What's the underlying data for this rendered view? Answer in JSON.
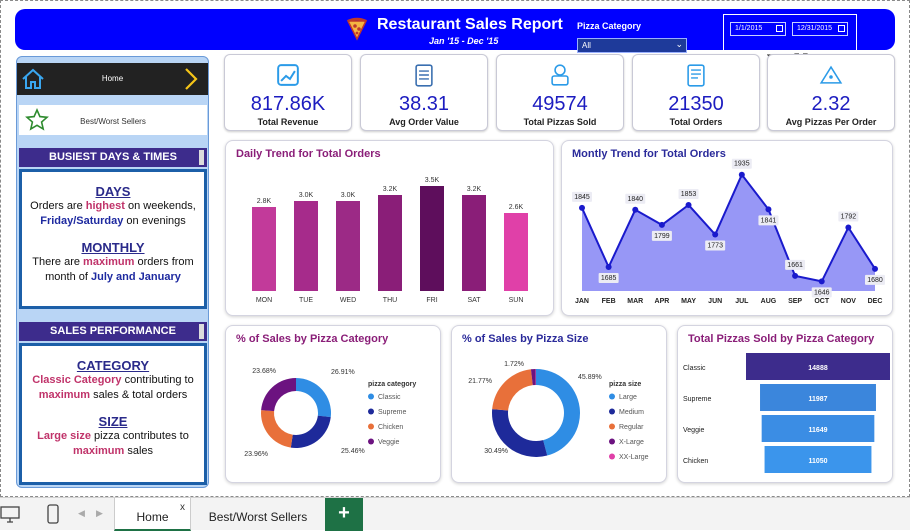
{
  "header": {
    "title": "Restaurant Sales Report",
    "subtitle": "Jan '15  -  Dec '15",
    "slicer_label": "Pizza Category",
    "slicer_value": "All",
    "date_start": "1/1/2015",
    "date_end": "12/31/2015"
  },
  "nav": {
    "home_label": "Home",
    "bw_label": "Best/Worst Sellers"
  },
  "busiest": {
    "header": "BUSIEST DAYS & TIMES",
    "days_heading": "DAYS",
    "days_l1a": "Orders are ",
    "days_l1b": "highest",
    "days_l1c": " on weekends,",
    "days_l2a": "Friday/Saturday",
    "days_l2b": " on evenings",
    "monthly_heading": "MONTHLY",
    "monthly_l1a": "There are ",
    "monthly_l1b": "maximum",
    "monthly_l1c": " orders from",
    "monthly_l2a": "month of ",
    "monthly_l2b": "July and January"
  },
  "performance": {
    "header": "SALES PERFORMANCE",
    "cat_heading": "CATEGORY",
    "cat_l1a": "Classic Category",
    "cat_l1b": " contributing to",
    "cat_l2a": "maximum",
    "cat_l2b": " sales & total orders",
    "size_heading": "SIZE",
    "size_l1a": "Large size",
    "size_l1b": " pizza contributes to",
    "size_l2a": "maximum",
    "size_l2b": " sales"
  },
  "kpis": [
    {
      "value": "817.86K",
      "label": "Total Revenue",
      "icon": "chart-icon"
    },
    {
      "value": "38.31",
      "label": "Avg Order Value",
      "icon": "clipboard-icon"
    },
    {
      "value": "49574",
      "label": "Total Pizzas Sold",
      "icon": "chef-icon"
    },
    {
      "value": "21350",
      "label": "Total Orders",
      "icon": "receipt-icon"
    },
    {
      "value": "2.32",
      "label": "Avg Pizzas Per Order",
      "icon": "pizza-slice-icon"
    }
  ],
  "colors": {
    "header_blue": "#0000ff",
    "navy": "#3d2c8c",
    "kpi_value": "#1c1cc0",
    "area": "#8c8cf5",
    "line": "#1a1acc"
  },
  "tabs": {
    "home": "Home",
    "bw": "Best/Worst Sellers",
    "add": "+",
    "close": "x"
  },
  "chart_data": [
    {
      "type": "bar",
      "title": "Daily Trend for Total Orders",
      "categories": [
        "MON",
        "TUE",
        "WED",
        "THU",
        "FRI",
        "SAT",
        "SUN"
      ],
      "values": [
        2.8,
        3.0,
        3.0,
        3.2,
        3.5,
        3.2,
        2.6
      ],
      "labels": [
        "2.8K",
        "3.0K",
        "3.0K",
        "3.2K",
        "3.5K",
        "3.2K",
        "2.6K"
      ],
      "colors": [
        "#c23a9a",
        "#a62b8b",
        "#9c2a86",
        "#8a1e78",
        "#5e0e5c",
        "#8a1e78",
        "#e040a8"
      ],
      "ylim": [
        0,
        3.5
      ]
    },
    {
      "type": "area",
      "title": "Montly Trend for Total Orders",
      "categories": [
        "JAN",
        "FEB",
        "MAR",
        "APR",
        "MAY",
        "JUN",
        "JUL",
        "AUG",
        "SEP",
        "OCT",
        "NOV",
        "DEC"
      ],
      "values": [
        1845,
        1685,
        1840,
        1799,
        1853,
        1773,
        1935,
        1841,
        1661,
        1646,
        1792,
        1680
      ],
      "ylim": [
        1620,
        1945
      ]
    },
    {
      "type": "pie",
      "title": "% of Sales by Pizza Category",
      "legend_title": "pizza category",
      "series": [
        {
          "name": "Classic",
          "value": 26.91,
          "label": "26.91%",
          "color": "#2f8de4"
        },
        {
          "name": "Supreme",
          "value": 25.46,
          "label": "25.46%",
          "color": "#1e2a9a"
        },
        {
          "name": "Chicken",
          "value": 23.96,
          "label": "23.96%",
          "color": "#e8703a"
        },
        {
          "name": "Veggie",
          "value": 23.68,
          "label": "23.68%",
          "color": "#6c1380"
        }
      ]
    },
    {
      "type": "pie",
      "title": "% of Sales by Pizza Size",
      "legend_title": "pizza size",
      "series": [
        {
          "name": "Large",
          "value": 45.89,
          "label": "45.89%",
          "color": "#2f8de4"
        },
        {
          "name": "Medium",
          "value": 30.49,
          "label": "30.49%",
          "color": "#1e2a9a"
        },
        {
          "name": "Regular",
          "value": 21.77,
          "label": "21.77%",
          "color": "#e8703a"
        },
        {
          "name": "X-Large",
          "value": 1.72,
          "label": "1.72%",
          "color": "#6c1380"
        },
        {
          "name": "XX-Large",
          "value": 0.12,
          "label": "",
          "color": "#e040a8"
        }
      ]
    },
    {
      "type": "bar",
      "title": "Total Pizzas Sold by Pizza Category",
      "categories": [
        "Classic",
        "Supreme",
        "Veggie",
        "Chicken"
      ],
      "values": [
        14888,
        11987,
        11649,
        11050
      ],
      "labels": [
        "14888",
        "11987",
        "11649",
        "11050"
      ],
      "colors": [
        "#3d2c8c",
        "#3b86dc",
        "#3b8de4",
        "#3b95ec"
      ]
    }
  ]
}
